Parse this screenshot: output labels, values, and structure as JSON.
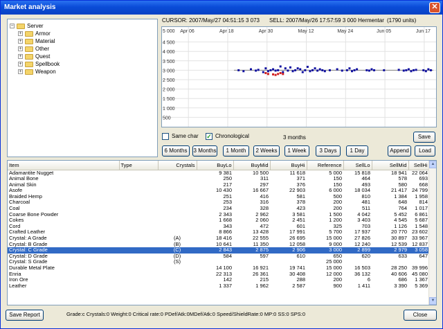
{
  "window": {
    "title": "Market analysis"
  },
  "tree": {
    "root": "Server",
    "children": [
      "Armor",
      "Material",
      "Other",
      "Quest",
      "Spellbook",
      "Weapon"
    ]
  },
  "info": {
    "cursor": "CURSOR: 2007/May/27 04:51:15  3 073",
    "sell": "SELL: 2007/May/26 17:57:59   3 000   Hermentar",
    "units": "(1790 units)"
  },
  "chart_data": {
    "type": "scatter",
    "x_tick_labels": [
      "Apr 06",
      "Apr 18",
      "Apr 30",
      "May 12",
      "May 24",
      "Jun 05",
      "Jun 17"
    ],
    "top_left_label": "5 000",
    "y_tick_labels": [
      "4 500",
      "4 000",
      "3 500",
      "3 000",
      "2 500",
      "2 000",
      "1 500",
      "1 000",
      "500"
    ],
    "ylim": [
      0,
      5000
    ],
    "grid": true,
    "series": [
      {
        "color": "#1010A0",
        "x_days": [
          3,
          5,
          8,
          10,
          11,
          13,
          14,
          15,
          16,
          17,
          18,
          19,
          20,
          21,
          22,
          23,
          24,
          25,
          26,
          27,
          28,
          29,
          30,
          31,
          32,
          33,
          34,
          35,
          36,
          37,
          38,
          40,
          43,
          45,
          47,
          48,
          49,
          50,
          51,
          55,
          56,
          57,
          58,
          62,
          68,
          70,
          71,
          72,
          73,
          74,
          75,
          78,
          79,
          80,
          81
        ],
        "values": [
          3000,
          2950,
          3050,
          2980,
          3020,
          2900,
          3100,
          2950,
          3000,
          3050,
          2980,
          3000,
          3200,
          2900,
          3100,
          2980,
          3150,
          2950,
          3000,
          3100,
          3050,
          2900,
          3000,
          3180,
          2950,
          3000,
          3100,
          2980,
          3050,
          3000,
          2950,
          3000,
          3050,
          2980,
          3000,
          3100,
          2950,
          3000,
          3050,
          3000,
          2980,
          3050,
          3000,
          3000,
          3020,
          2980,
          3000,
          3050,
          2950,
          3000,
          3020,
          3000,
          2950,
          3050,
          3000
        ]
      },
      {
        "color": "#D02020",
        "x_days": [
          14,
          15,
          17,
          18,
          19,
          20,
          21
        ],
        "values": [
          2850,
          2800,
          2780,
          2750,
          2800,
          2850,
          2800
        ]
      }
    ],
    "trend_line": {
      "color": "#808080",
      "x_days": [
        0,
        82
      ],
      "values": [
        3000,
        3000
      ]
    }
  },
  "controls": {
    "same_char": "Same char",
    "chronological": "Chronological",
    "period_text": "3 months",
    "save": "Save",
    "periods": [
      "6 Months",
      "3 Months",
      "1 Month",
      "2 Weeks",
      "1 Week",
      "3 Days",
      "1 Day"
    ],
    "append": "Append",
    "load": "Load"
  },
  "table": {
    "columns": [
      "Item",
      "Type",
      "Crystals",
      "BuyLo",
      "BuyMid",
      "BuyHi",
      "Reference",
      "SellLo",
      "SellMid",
      "SellHi"
    ],
    "rows": [
      [
        "Adamantite Nugget",
        "",
        "",
        "9 381",
        "10 500",
        "11 618",
        "5 000",
        "15 818",
        "18 941",
        "22 064"
      ],
      [
        "Animal Bone",
        "",
        "",
        "250",
        "311",
        "371",
        "150",
        "464",
        "578",
        "693"
      ],
      [
        "Animal Skin",
        "",
        "",
        "217",
        "297",
        "376",
        "150",
        "493",
        "580",
        "668"
      ],
      [
        "Asofe",
        "",
        "",
        "10 430",
        "16 667",
        "22 903",
        "6 000",
        "18 034",
        "21 417",
        "24 799"
      ],
      [
        "Braided Hemp",
        "",
        "",
        "251",
        "416",
        "581",
        "500",
        "810",
        "1 384",
        "1 958"
      ],
      [
        "Charcoal",
        "",
        "",
        "253",
        "316",
        "378",
        "200",
        "481",
        "648",
        "814"
      ],
      [
        "Coal",
        "",
        "",
        "234",
        "328",
        "423",
        "200",
        "511",
        "764",
        "1 017"
      ],
      [
        "Coarse Bone Powder",
        "",
        "",
        "2 343",
        "2 962",
        "3 581",
        "1 500",
        "4 042",
        "5 452",
        "6 861"
      ],
      [
        "Cokes",
        "",
        "",
        "1 668",
        "2 060",
        "2 451",
        "1 200",
        "3 403",
        "4 545",
        "5 687"
      ],
      [
        "Cord",
        "",
        "",
        "343",
        "472",
        "601",
        "325",
        "703",
        "1 126",
        "1 548"
      ],
      [
        "Crafted Leather",
        "",
        "",
        "8 866",
        "13 428",
        "17 991",
        "5 700",
        "17 937",
        "20 770",
        "23 602"
      ],
      [
        "Crystal: A Grade",
        "",
        "(A)",
        "18 416",
        "22 555",
        "26 695",
        "15 000",
        "27 826",
        "30 897",
        "33 967"
      ],
      [
        "Crystal: B Grade",
        "",
        "(B)",
        "10 641",
        "11 350",
        "12 058",
        "9 000",
        "12 240",
        "12 539",
        "12 837"
      ],
      [
        "Crystal: C Grade",
        "",
        "(C)",
        "2 843",
        "2 875",
        "2 906",
        "3 000",
        "2 899",
        "2 979",
        "3 058"
      ],
      [
        "Crystal: D Grade",
        "",
        "(D)",
        "584",
        "597",
        "610",
        "650",
        "620",
        "633",
        "647"
      ],
      [
        "Crystal: S Grade",
        "",
        "(S)",
        "",
        "",
        "",
        "25 000",
        "",
        "",
        ""
      ],
      [
        "Durable Metal Plate",
        "",
        "",
        "14 100",
        "16 921",
        "19 741",
        "15 000",
        "16 503",
        "28 250",
        "39 996"
      ],
      [
        "Enria",
        "",
        "",
        "22 313",
        "26 361",
        "30 408",
        "12 000",
        "36 132",
        "40 606",
        "45 080"
      ],
      [
        "Iron Ore",
        "",
        "",
        "142",
        "215",
        "288",
        "200",
        "6",
        "686",
        "1 367"
      ],
      [
        "Leather",
        "",
        "",
        "1 337",
        "1 962",
        "2 587",
        "900",
        "1 411",
        "3 390",
        "5 369"
      ]
    ],
    "selected_row": 13
  },
  "status": "Grade:c  Crystals:0  Weight:0  Critical rate:0  PDef/Atk:0MDef/Atk:0  Speed/ShieldRate:0  MP:0  SS:0  SPS:0",
  "footer": {
    "save_report": "Save Report",
    "close": "Close"
  }
}
